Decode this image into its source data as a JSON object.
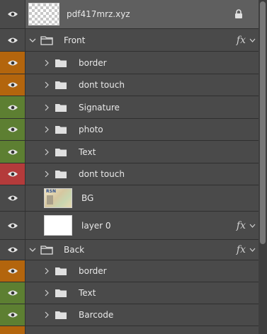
{
  "layers": {
    "document_layer": "pdf417mrz.xyz",
    "front_group": "Front",
    "front_items": [
      "border",
      "dont touch",
      "Signature",
      "photo",
      "Text",
      "dont touch"
    ],
    "bg_layer": "BG",
    "layer0": "layer 0",
    "back_group": "Back",
    "back_items": [
      "border",
      "Text",
      "Barcode"
    ],
    "fx_label": "fx",
    "bg_thumb_text": "RSN"
  },
  "icons": {
    "visibility": "eye-icon",
    "folder": "folder-icon",
    "lock": "lock-icon",
    "expand": "chevron-right-icon",
    "collapse": "chevron-down-icon",
    "fx_menu": "chevron-down-icon"
  },
  "colors": {
    "orange_label": "#b3650d",
    "green_label": "#5d7f32",
    "red_label": "#b43b3b",
    "panel_bg": "#535353"
  }
}
